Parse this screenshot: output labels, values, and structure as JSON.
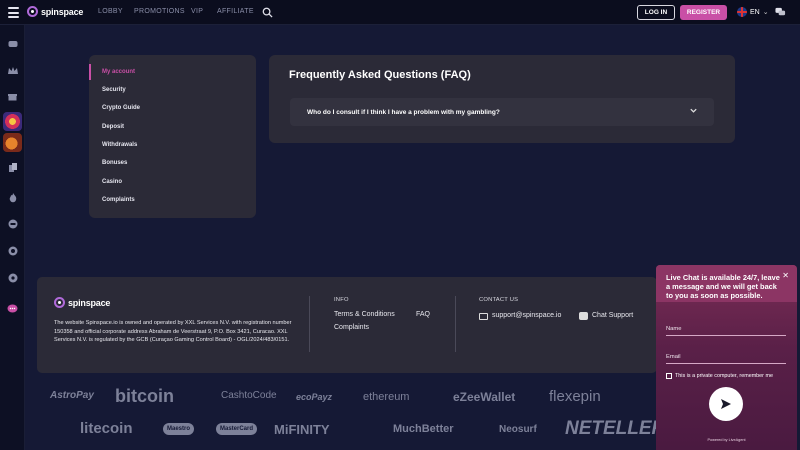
{
  "header": {
    "brand": "spinspace",
    "nav": [
      "LOBBY",
      "PROMOTIONS",
      "VIP",
      "AFFILIATE"
    ],
    "login_label": "LOG IN",
    "register_label": "REGISTER",
    "language": "EN",
    "icons": [
      "menu-icon",
      "search-icon",
      "uk-flag-icon",
      "chevron-down-icon",
      "chat-bubbles-icon"
    ]
  },
  "sidebar": {
    "icons": [
      "casino-chip-icon",
      "crown-icon",
      "gift-icon",
      "wheel-of-fortune-game",
      "mascot-game",
      "cards-icon",
      "fire-icon",
      "live-icon",
      "target-icon",
      "settings-icon",
      "support-chat-icon"
    ]
  },
  "account_menu": {
    "items": [
      "My account",
      "Security",
      "Crypto Guide",
      "Deposit",
      "Withdrawals",
      "Bonuses",
      "Casino",
      "Complaints"
    ],
    "active": "My account"
  },
  "faq": {
    "title": "Frequently Asked Questions (FAQ)",
    "questions": [
      "Who do I consult if I think I have a problem with my gambling?"
    ]
  },
  "footer": {
    "brand": "spinspace",
    "about": "The website Spinspace.io is owned and operated by XXL Services N.V. with registration number 150358 and official corporate address Abraham de Veerstraat 9, P.O. Box 3421, Curacao. XXL Services N.V. is regulated by the GCB (Curaçao Gaming Control Board) - OGL/2024/483/0151.",
    "info_heading": "INFO",
    "info_links": [
      "Terms & Conditions",
      "FAQ",
      "Complaints"
    ],
    "contact_heading": "CONTACT US",
    "contact_email": "support@spinspace.io",
    "contact_chat": "Chat Support"
  },
  "payments": [
    "AstroPay",
    "bitcoin",
    "CashtoCode",
    "ecoPayz",
    "ethereum",
    "eZeeWallet",
    "flexepin",
    "litecoin",
    "Maestro",
    "MasterCard",
    "MiFINITY",
    "MuchBetter",
    "Neosurf",
    "NETELLER"
  ],
  "payments_sub": [
    "CashtoCode",
    "ecoPayz",
    "ethereum",
    "eZeeWallet"
  ],
  "live_chat": {
    "message": "Live Chat is available 24/7, leave a message and we will get back to you as soon as possible.",
    "name_label": "Name",
    "email_label": "Email",
    "private_label": "This is a private computer, remember me",
    "powered": "Powered by LiveAgent"
  },
  "colors": {
    "accent": "#c94fa6",
    "panel": "#2b2a37",
    "background": "#151935",
    "chat_widget": "#7b2d55"
  }
}
